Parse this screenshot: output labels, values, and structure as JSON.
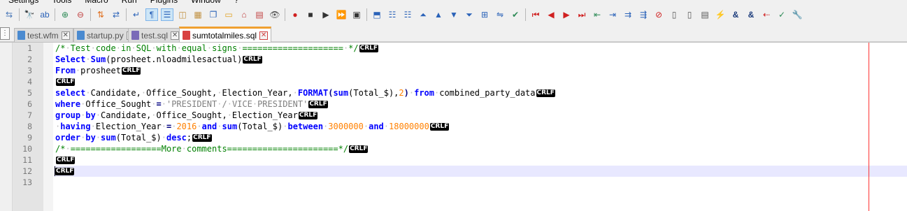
{
  "menu": {
    "items": [
      "Settings",
      "Tools",
      "Macro",
      "Run",
      "Plugins",
      "Window",
      "?"
    ]
  },
  "toolbar": {
    "buttons": [
      {
        "name": "indent-icon",
        "glyph": "⇆",
        "color": "#4a78b8"
      },
      {
        "name": "find-icon",
        "glyph": "🔭",
        "color": "#333333"
      },
      {
        "name": "replace-icon",
        "glyph": "ab",
        "color": "#2a62b8"
      },
      {
        "name": "zoom-in-icon",
        "glyph": "⊕",
        "color": "#2e8b57"
      },
      {
        "name": "zoom-out-icon",
        "glyph": "⊖",
        "color": "#c04040"
      },
      {
        "name": "sync-vertical-icon",
        "glyph": "⇅",
        "color": "#e07020"
      },
      {
        "name": "sync-horizontal-icon",
        "glyph": "⇄",
        "color": "#2a62b8"
      },
      {
        "name": "word-wrap-icon",
        "glyph": "↵",
        "color": "#2a62b8"
      },
      {
        "name": "show-all-chars-icon",
        "glyph": "¶",
        "color": "#2a62b8"
      },
      {
        "name": "indent-guide-icon",
        "glyph": "☰",
        "color": "#2a62b8"
      },
      {
        "name": "user-defined-lang-icon",
        "glyph": "◫",
        "color": "#c09040"
      },
      {
        "name": "doc-map-icon",
        "glyph": "▦",
        "color": "#c09040"
      },
      {
        "name": "function-list-icon",
        "glyph": "❐",
        "color": "#2a62b8"
      },
      {
        "name": "folder-workspace-icon",
        "glyph": "▭",
        "color": "#e0a020"
      },
      {
        "name": "monitoring-icon",
        "glyph": "⌂",
        "color": "#c04040"
      },
      {
        "name": "spellcheck-icon",
        "glyph": "▤",
        "color": "#c04040"
      },
      {
        "name": "preview-icon",
        "glyph": "👁",
        "color": "#555555"
      },
      {
        "name": "record-macro-icon",
        "glyph": "●",
        "color": "#d02020"
      },
      {
        "name": "stop-macro-icon",
        "glyph": "■",
        "color": "#333333"
      },
      {
        "name": "play-macro-icon",
        "glyph": "▶",
        "color": "#333333"
      },
      {
        "name": "run-macro-multiple-icon",
        "glyph": "⏩",
        "color": "#2a62b8"
      },
      {
        "name": "save-macro-icon",
        "glyph": "▣",
        "color": "#333333"
      },
      {
        "name": "bookmark-icon",
        "glyph": "⬒",
        "color": "#2a62b8"
      },
      {
        "name": "list-icon",
        "glyph": "☷",
        "color": "#2a62b8"
      },
      {
        "name": "list-alt-icon",
        "glyph": "☷",
        "color": "#2a62b8"
      },
      {
        "name": "collapse-icon",
        "glyph": "⏶",
        "color": "#2a62b8"
      },
      {
        "name": "up-icon",
        "glyph": "▲",
        "color": "#2a62b8"
      },
      {
        "name": "down-icon",
        "glyph": "▼",
        "color": "#2a62b8"
      },
      {
        "name": "expand-icon",
        "glyph": "⏷",
        "color": "#2a62b8"
      },
      {
        "name": "grid-icon",
        "glyph": "⊞",
        "color": "#2a62b8"
      },
      {
        "name": "compare-icon",
        "glyph": "⇋",
        "color": "#2a62b8"
      },
      {
        "name": "check-icon",
        "glyph": "✔",
        "color": "#2e8b57"
      },
      {
        "name": "first-icon",
        "glyph": "⏮",
        "color": "#d02020"
      },
      {
        "name": "prev-icon",
        "glyph": "◀",
        "color": "#d02020"
      },
      {
        "name": "next-icon",
        "glyph": "▶",
        "color": "#d02020"
      },
      {
        "name": "last-icon",
        "glyph": "⏭",
        "color": "#d02020"
      },
      {
        "name": "diff-prev-icon",
        "glyph": "⇤",
        "color": "#2e8b57"
      },
      {
        "name": "diff-next-icon",
        "glyph": "⇥",
        "color": "#2a62b8"
      },
      {
        "name": "diff-export-icon",
        "glyph": "⇉",
        "color": "#2a62b8"
      },
      {
        "name": "diff-clear-icon",
        "glyph": "⇶",
        "color": "#2a62b8"
      },
      {
        "name": "no-compare-icon",
        "glyph": "⊘",
        "color": "#d02020"
      },
      {
        "name": "doc-icon",
        "glyph": "▯",
        "color": "#555555"
      },
      {
        "name": "doc-alt-icon",
        "glyph": "▯",
        "color": "#555555"
      },
      {
        "name": "doc-lines-icon",
        "glyph": "▤",
        "color": "#555555"
      },
      {
        "name": "lightning-icon",
        "glyph": "⚡",
        "color": "#e0a020"
      },
      {
        "name": "ampersand-icon",
        "glyph": "&",
        "color": "#1a3a7a"
      },
      {
        "name": "ampersand-off-icon",
        "glyph": "&",
        "color": "#1a3a7a"
      },
      {
        "name": "tag-prev-icon",
        "glyph": "⇠",
        "color": "#d02020"
      },
      {
        "name": "tag-check-icon",
        "glyph": "✓",
        "color": "#2e8b57"
      },
      {
        "name": "settings-icon",
        "glyph": "🔧",
        "color": "#555555"
      }
    ]
  },
  "tabs": [
    {
      "label": "test.wfm",
      "icon_color": "#4a8ad0",
      "active": false
    },
    {
      "label": "startup.py",
      "icon_color": "#4a8ad0",
      "active": false
    },
    {
      "label": "test.sql",
      "icon_color": "#7a6ab8",
      "active": false
    },
    {
      "label": "sumtotalmiles.sql",
      "icon_color": "#d84040",
      "active": true
    }
  ],
  "doc_list_glyph": "⋮",
  "close_glyph": "✕",
  "eol_marker": "CRLF",
  "editor": {
    "current_line": 12,
    "lines": [
      {
        "n": "1",
        "tokens": [
          [
            "cm",
            "/* Test code in SQL with equal signs ==================== */"
          ]
        ]
      },
      {
        "n": "2",
        "tokens": [
          [
            "kw",
            "Select"
          ],
          [
            "id",
            " "
          ],
          [
            "kw",
            "Sum"
          ],
          [
            "id",
            "(prosheet.nloadmilesactual)"
          ]
        ]
      },
      {
        "n": "3",
        "tokens": [
          [
            "kw",
            "From"
          ],
          [
            "id",
            " prosheet"
          ]
        ]
      },
      {
        "n": "4",
        "tokens": []
      },
      {
        "n": "5",
        "tokens": [
          [
            "kw",
            "select"
          ],
          [
            "id",
            " Candidate, Office_Sought, Election_Year, "
          ],
          [
            "kw",
            "FORMAT"
          ],
          [
            "op",
            "("
          ],
          [
            "kw",
            "sum"
          ],
          [
            "id",
            "(Total_$),"
          ],
          [
            "num",
            "2"
          ],
          [
            "op",
            ")"
          ],
          [
            "id",
            " "
          ],
          [
            "kw",
            "from"
          ],
          [
            "id",
            " combined_party_data"
          ]
        ]
      },
      {
        "n": "6",
        "tokens": [
          [
            "kw",
            "where"
          ],
          [
            "id",
            " Office_Sought "
          ],
          [
            "op",
            "="
          ],
          [
            "id",
            " "
          ],
          [
            "str",
            "'PRESIDENT / VICE PRESIDENT'"
          ]
        ]
      },
      {
        "n": "7",
        "tokens": [
          [
            "kw",
            "group"
          ],
          [
            "id",
            " "
          ],
          [
            "kw",
            "by"
          ],
          [
            "id",
            " Candidate, Office_Sought, Election_Year"
          ]
        ]
      },
      {
        "n": "8",
        "tokens": [
          [
            "id",
            " "
          ],
          [
            "kw",
            "having"
          ],
          [
            "id",
            " Election_Year "
          ],
          [
            "op",
            "="
          ],
          [
            "id",
            " "
          ],
          [
            "num",
            "2016"
          ],
          [
            "id",
            " "
          ],
          [
            "kw",
            "and"
          ],
          [
            "id",
            " "
          ],
          [
            "kw",
            "sum"
          ],
          [
            "id",
            "(Total_$) "
          ],
          [
            "kw",
            "between"
          ],
          [
            "id",
            " "
          ],
          [
            "num",
            "3000000"
          ],
          [
            "id",
            " "
          ],
          [
            "kw",
            "and"
          ],
          [
            "id",
            " "
          ],
          [
            "num",
            "18000000"
          ]
        ]
      },
      {
        "n": "9",
        "tokens": [
          [
            "kw",
            "order"
          ],
          [
            "id",
            " "
          ],
          [
            "kw",
            "by"
          ],
          [
            "id",
            " "
          ],
          [
            "kw",
            "sum"
          ],
          [
            "id",
            "(Total_$) "
          ],
          [
            "kw",
            "desc"
          ],
          [
            "id",
            ";"
          ]
        ]
      },
      {
        "n": "10",
        "tokens": [
          [
            "cm",
            "/* ==================More comments======================*/"
          ]
        ]
      },
      {
        "n": "11",
        "tokens": []
      },
      {
        "n": "12",
        "tokens": []
      },
      {
        "n": "13",
        "tokens": [],
        "no_eol": true
      }
    ]
  }
}
